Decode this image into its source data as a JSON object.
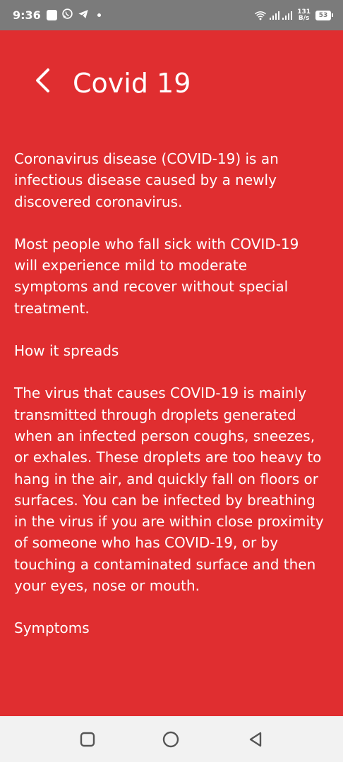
{
  "status_bar": {
    "time": "9:36",
    "net_speed_value": "131",
    "net_speed_unit": "B/s",
    "battery": "53"
  },
  "header": {
    "title": "Covid 19"
  },
  "content": {
    "paragraphs": [
      "Coronavirus disease (COVID-19) is an infectious disease caused by a newly discovered coronavirus.",
      "Most people who fall sick with COVID-19 will experience mild to moderate symptoms and recover without special treatment.",
      "How it spreads",
      "The virus that causes COVID-19 is mainly transmitted through droplets generated when an infected person coughs, sneezes, or exhales. These droplets are too heavy to hang in the air, and quickly fall on floors or surfaces. You can be infected by breathing in the virus if you are within close proximity of someone who has COVID-19, or by touching a contaminated surface and then your eyes, nose or mouth.",
      "Symptoms"
    ]
  },
  "colors": {
    "background": "#e02e30",
    "status_bar": "#7b7b7b",
    "nav_bar": "#f2f2f2"
  }
}
